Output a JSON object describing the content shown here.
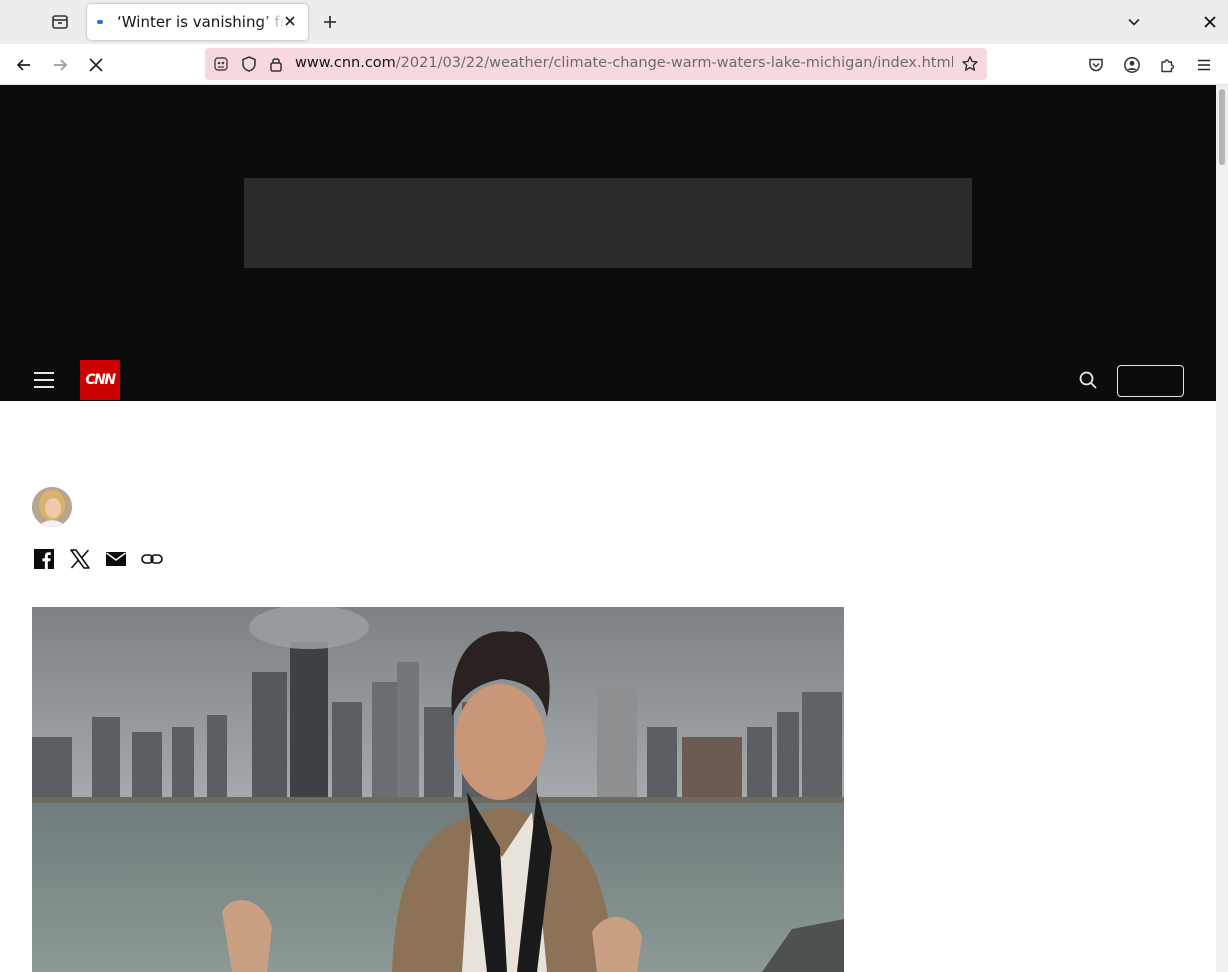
{
  "browser": {
    "tab": {
      "title": "‘Winter is vanishing’ from Lake Michigan"
    },
    "url": {
      "domain": "www.cnn.com",
      "path": "/2021/03/22/weather/climate-change-warm-waters-lake-michigan/index.html"
    }
  },
  "cnn": {
    "logo_text": "CNN",
    "signin_label": ""
  },
  "icons": {
    "tab_list": "tab-list-icon",
    "new_tab": "plus-icon",
    "list_all_tabs": "chevron-down-icon",
    "window_close": "close-icon",
    "back": "arrow-left-icon",
    "forward": "arrow-right-icon",
    "stop": "close-icon",
    "share": [
      "facebook-icon",
      "x-icon",
      "email-icon",
      "link-icon"
    ]
  },
  "colors": {
    "cnn_red": "#cc0000",
    "header_black": "#0c0c0c",
    "urlbar_tint": "#f5d9dd"
  }
}
